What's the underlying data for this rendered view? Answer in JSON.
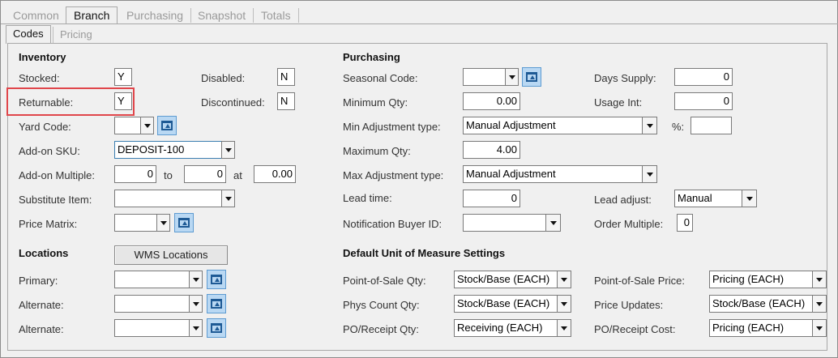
{
  "tabs": [
    "Common",
    "Branch",
    "Purchasing",
    "Snapshot",
    "Totals"
  ],
  "subtabs": [
    "Codes",
    "Pricing"
  ],
  "inventory": {
    "title": "Inventory",
    "stocked_label": "Stocked:",
    "stocked": "Y",
    "disabled_label": "Disabled:",
    "disabled": "N",
    "returnable_label": "Returnable:",
    "returnable": "Y",
    "discontinued_label": "Discontinued:",
    "discontinued": "N",
    "yard_code_label": "Yard Code:",
    "yard_code": "",
    "addon_sku_label": "Add-on SKU:",
    "addon_sku": "DEPOSIT-100",
    "addon_multiple_label": "Add-on Multiple:",
    "addon_multiple_from": "0",
    "to_label": "to",
    "addon_multiple_to": "0",
    "at_label": "at",
    "addon_multiple_at": "0.00",
    "substitute_label": "Substitute Item:",
    "substitute": "",
    "price_matrix_label": "Price Matrix:",
    "price_matrix": ""
  },
  "locations": {
    "title": "Locations",
    "wms_button": "WMS Locations",
    "primary_label": "Primary:",
    "primary": "",
    "alternate1_label": "Alternate:",
    "alternate1": "",
    "alternate2_label": "Alternate:",
    "alternate2": ""
  },
  "purchasing": {
    "title": "Purchasing",
    "seasonal_label": "Seasonal Code:",
    "seasonal": "",
    "days_supply_label": "Days Supply:",
    "days_supply": "0",
    "min_qty_label": "Minimum Qty:",
    "min_qty": "0.00",
    "usage_int_label": "Usage Int:",
    "usage_int": "0",
    "min_adj_label": "Min Adjustment type:",
    "min_adj": "Manual Adjustment",
    "pct_label": "%:",
    "pct": "",
    "max_qty_label": "Maximum Qty:",
    "max_qty": "4.00",
    "max_adj_label": "Max Adjustment type:",
    "max_adj": "Manual Adjustment",
    "lead_time_label": "Lead time:",
    "lead_time": "0",
    "lead_adjust_label": "Lead adjust:",
    "lead_adjust": "Manual",
    "notif_label": "Notification Buyer ID:",
    "notif": "",
    "order_mult_label": "Order Multiple:",
    "order_mult": "0"
  },
  "uom": {
    "title": "Default Unit of Measure Settings",
    "pos_qty_label": "Point-of-Sale Qty:",
    "pos_qty": "Stock/Base (EACH)",
    "pos_price_label": "Point-of-Sale Price:",
    "pos_price": "Pricing (EACH)",
    "phys_label": "Phys Count Qty:",
    "phys": "Stock/Base (EACH)",
    "price_upd_label": "Price Updates:",
    "price_upd": "Stock/Base (EACH)",
    "po_qty_label": "PO/Receipt Qty:",
    "po_qty": "Receiving (EACH)",
    "po_cost_label": "PO/Receipt Cost:",
    "po_cost": "Pricing (EACH)"
  },
  "colors": {
    "highlight": "#e0464b",
    "lookup": "#b9d8f3"
  }
}
